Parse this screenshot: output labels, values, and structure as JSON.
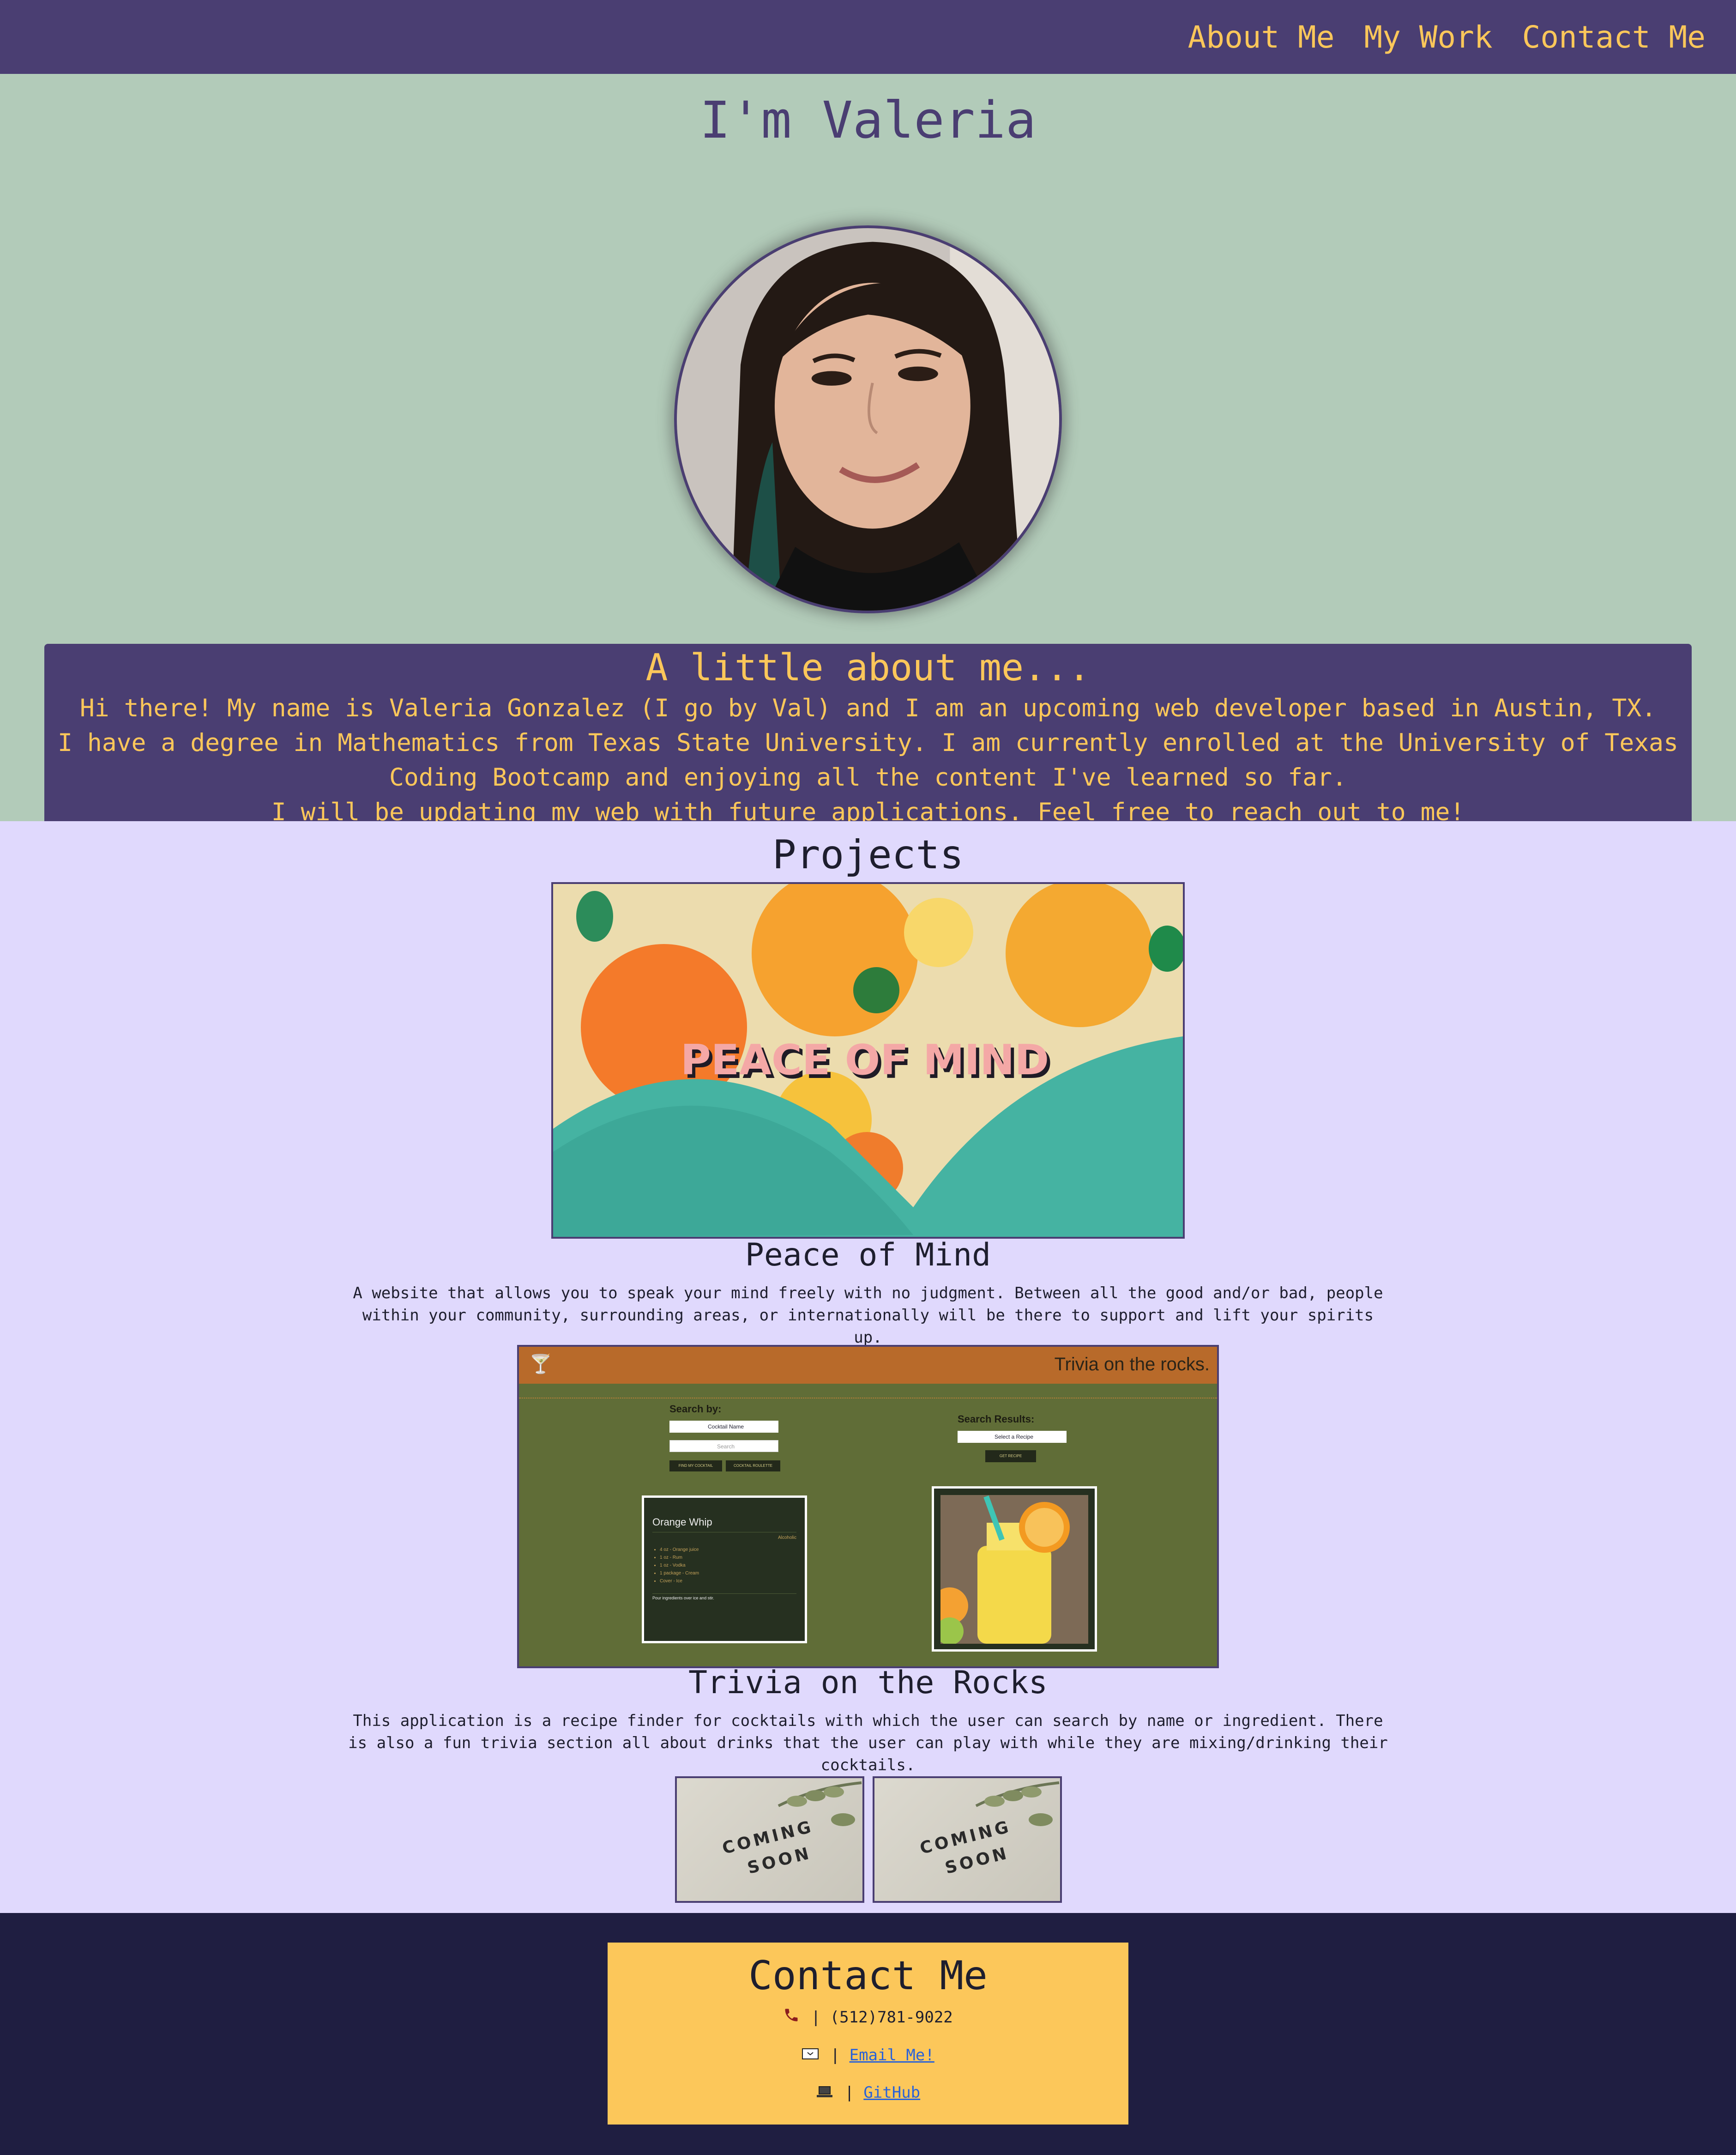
{
  "nav": {
    "links": [
      "About Me",
      "My Work",
      "Contact Me"
    ]
  },
  "hero": {
    "title": "I'm Valeria"
  },
  "about": {
    "heading": "A little about me...",
    "lines": [
      "Hi there! My name is Valeria Gonzalez (I go by Val) and I am an upcoming web developer based in Austin, TX.",
      "I have a degree in Mathematics from Texas State University. I am currently enrolled at the University of Texas Coding Bootcamp and enjoying all the content I've learned so far.",
      "I will be updating my web with future applications. Feel free to reach out to me!"
    ]
  },
  "projects": {
    "heading": "Projects",
    "items": [
      {
        "title": "Peace of Mind",
        "image_text": "PEACE OF MIND",
        "description": "A website that allows you to speak your mind freely with no judgment. Between all the good and/or bad, people within your community, surrounding areas, or internationally will be there to support and lift your spirits up."
      },
      {
        "title": "Trivia on the Rocks",
        "image_header": "Trivia on the rocks.",
        "image_search_label": "Search by:",
        "image_select": "Cocktail Name",
        "image_search_placeholder": "Search",
        "image_btn1": "FIND MY COCKTAIL",
        "image_btn2": "COCKTAIL ROULETTE",
        "image_results_label": "Search Results:",
        "image_results_select": "Select a Recipe",
        "image_results_btn": "GET RECIPE",
        "image_card_title": "Orange Whip",
        "image_card_tag": "Alcoholic",
        "image_card_items": [
          "4 oz - Orange juice",
          "1 oz - Rum",
          "1 oz - Vodka",
          "1 package - Cream",
          "Cover - Ice"
        ],
        "image_card_footer": "Pour ingredients over ice and stir.",
        "description": "This application is a recipe finder for cocktails with which the user can search by name or ingredient. There is also a fun trivia section all about drinks that the user can play with while they are mixing/drinking their cocktails."
      }
    ],
    "coming_soon": [
      "COMING",
      "SOON"
    ]
  },
  "contact": {
    "heading": "Contact Me",
    "phone": "(512)781-9022",
    "email_label": "Email Me!",
    "github_label": "GitHub",
    "separator": "|"
  },
  "colors": {
    "nav_bg": "#4a3e72",
    "accent": "#fcc75a",
    "hero_bg": "#b2cbb9",
    "projects_bg": "#e0d9fd",
    "footer_bg": "#1f1e41"
  }
}
